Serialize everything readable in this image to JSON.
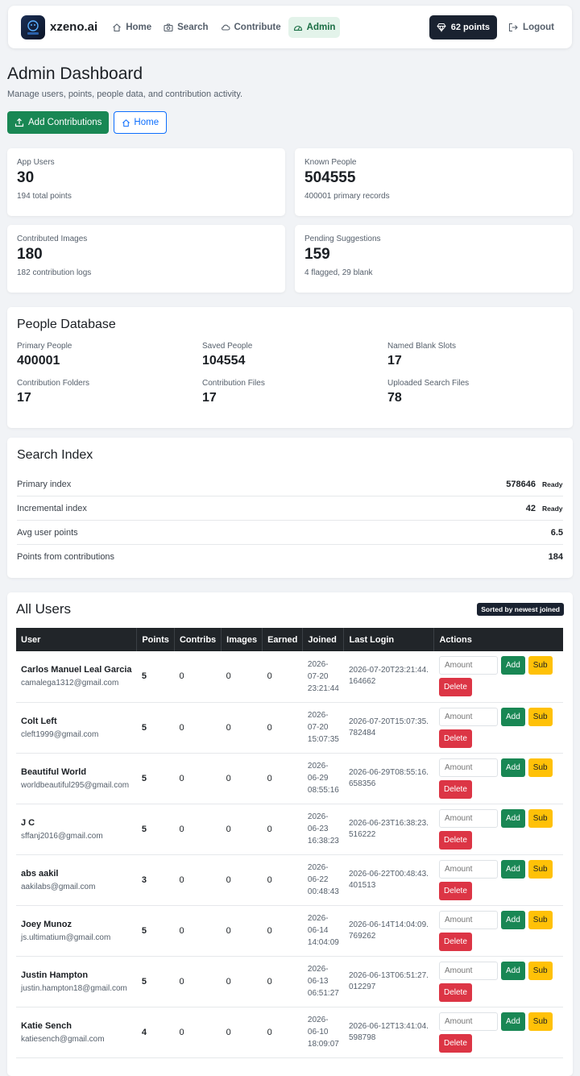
{
  "nav": {
    "brand": "xzeno.ai",
    "links": [
      {
        "label": "Home",
        "icon": "home-icon"
      },
      {
        "label": "Search",
        "icon": "camera-icon"
      },
      {
        "label": "Contribute",
        "icon": "cloud-upload-icon"
      },
      {
        "label": "Admin",
        "icon": "gauge-icon"
      }
    ],
    "points": "62 points",
    "logout": "Logout"
  },
  "header": {
    "title": "Admin Dashboard",
    "subtitle": "Manage users, points, people data, and contribution activity.",
    "add_contributions": "Add Contributions",
    "home": "Home"
  },
  "stats": [
    {
      "label": "App Users",
      "value": "30",
      "sub": "194 total points"
    },
    {
      "label": "Known People",
      "value": "504555",
      "sub": "400001 primary records"
    },
    {
      "label": "Contributed Images",
      "value": "180",
      "sub": "182 contribution logs"
    },
    {
      "label": "Pending Suggestions",
      "value": "159",
      "sub": "4 flagged, 29 blank"
    }
  ],
  "people_db": {
    "title": "People Database",
    "items": [
      {
        "label": "Primary People",
        "value": "400001"
      },
      {
        "label": "Saved People",
        "value": "104554"
      },
      {
        "label": "Named Blank Slots",
        "value": "17"
      },
      {
        "label": "Contribution Folders",
        "value": "17"
      },
      {
        "label": "Contribution Files",
        "value": "17"
      },
      {
        "label": "Uploaded Search Files",
        "value": "78"
      }
    ]
  },
  "search_index": {
    "title": "Search Index",
    "rows": [
      {
        "label": "Primary index",
        "value": "578646",
        "status": "Ready"
      },
      {
        "label": "Incremental index",
        "value": "42",
        "status": "Ready"
      },
      {
        "label": "Avg user points",
        "value": "6.5",
        "status": ""
      },
      {
        "label": "Points from contributions",
        "value": "184",
        "status": ""
      }
    ]
  },
  "users": {
    "title": "All Users",
    "badge": "Sorted by newest joined",
    "columns": [
      "User",
      "Points",
      "Contribs",
      "Images",
      "Earned",
      "Joined",
      "Last Login",
      "Actions"
    ],
    "amount_placeholder": "Amount",
    "add_label": "Add",
    "sub_label": "Sub",
    "delete_label": "Delete",
    "rows": [
      {
        "name": "Carlos Manuel Leal Garcia",
        "email": "camalega1312@gmail.com",
        "points": "5",
        "contribs": "0",
        "images": "0",
        "earned": "0",
        "joined": "2026-07-20 23:21:44",
        "last_login": "2026-07-20T23:21:44.164662"
      },
      {
        "name": "Colt Left",
        "email": "cleft1999@gmail.com",
        "points": "5",
        "contribs": "0",
        "images": "0",
        "earned": "0",
        "joined": "2026-07-20 15:07:35",
        "last_login": "2026-07-20T15:07:35.782484"
      },
      {
        "name": "Beautiful World",
        "email": "worldbeautiful295@gmail.com",
        "points": "5",
        "contribs": "0",
        "images": "0",
        "earned": "0",
        "joined": "2026-06-29 08:55:16",
        "last_login": "2026-06-29T08:55:16.658356"
      },
      {
        "name": "J C",
        "email": "sffanj2016@gmail.com",
        "points": "5",
        "contribs": "0",
        "images": "0",
        "earned": "0",
        "joined": "2026-06-23 16:38:23",
        "last_login": "2026-06-23T16:38:23.516222"
      },
      {
        "name": "abs aakil",
        "email": "aakilabs@gmail.com",
        "points": "3",
        "contribs": "0",
        "images": "0",
        "earned": "0",
        "joined": "2026-06-22 00:48:43",
        "last_login": "2026-06-22T00:48:43.401513"
      },
      {
        "name": "Joey Munoz",
        "email": "js.ultimatium@gmail.com",
        "points": "5",
        "contribs": "0",
        "images": "0",
        "earned": "0",
        "joined": "2026-06-14 14:04:09",
        "last_login": "2026-06-14T14:04:09.769262"
      },
      {
        "name": "Justin Hampton",
        "email": "justin.hampton18@gmail.com",
        "points": "5",
        "contribs": "0",
        "images": "0",
        "earned": "0",
        "joined": "2026-06-13 06:51:27",
        "last_login": "2026-06-13T06:51:27.012297"
      },
      {
        "name": "Katie Sench",
        "email": "katiesench@gmail.com",
        "points": "4",
        "contribs": "0",
        "images": "0",
        "earned": "0",
        "joined": "2026-06-10 18:09:07",
        "last_login": "2026-06-12T13:41:04.598798"
      }
    ]
  }
}
